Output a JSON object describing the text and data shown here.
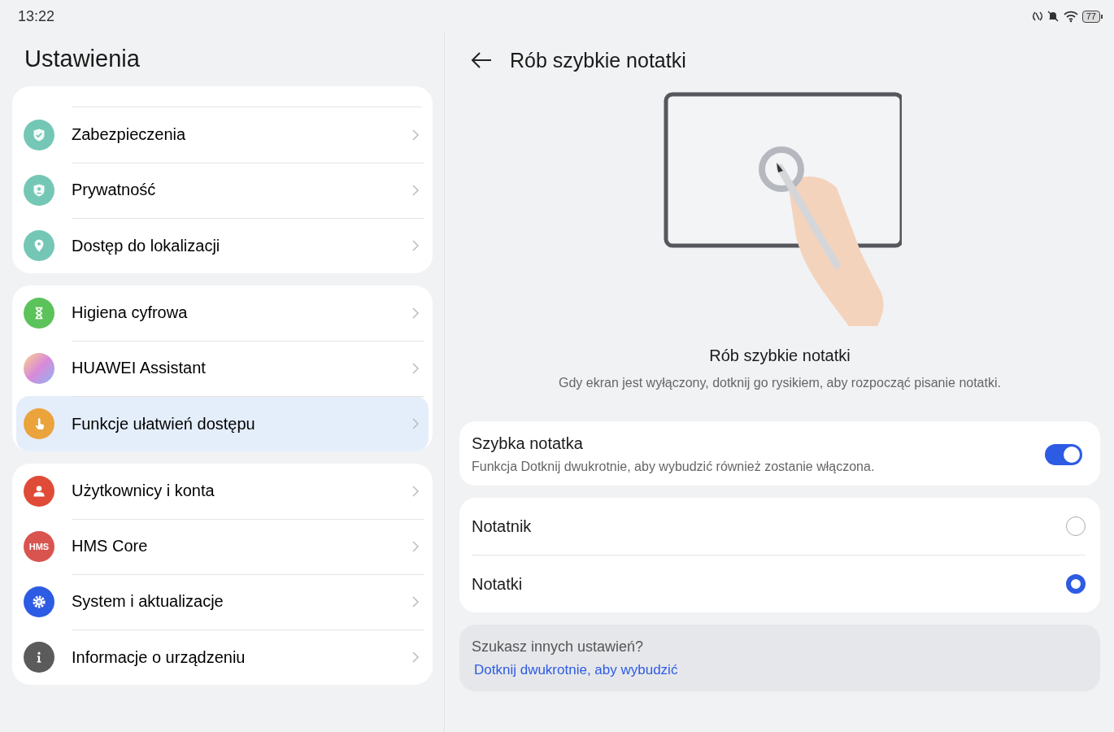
{
  "status_bar": {
    "time": "13:22",
    "battery": "77"
  },
  "sidebar": {
    "title": "Ustawienia",
    "groups": [
      {
        "kind": "scrolled",
        "items": [
          {
            "label": "Zabezpieczenia",
            "kind": "shield",
            "selected": false
          },
          {
            "label": "Prywatność",
            "kind": "privacy",
            "selected": false
          },
          {
            "label": "Dostęp do lokalizacji",
            "kind": "location",
            "selected": false
          }
        ]
      },
      {
        "kind": "full",
        "items": [
          {
            "label": "Higiena cyfrowa",
            "kind": "hourglass",
            "selected": false
          },
          {
            "label": "HUAWEI Assistant",
            "kind": "assistant",
            "selected": false
          },
          {
            "label": "Funkcje ułatwień dostępu",
            "kind": "hand",
            "selected": true
          }
        ]
      },
      {
        "kind": "full",
        "items": [
          {
            "label": "Użytkownicy i konta",
            "kind": "user",
            "selected": false
          },
          {
            "label": "HMS Core",
            "kind": "hms",
            "icon_text": "HMS",
            "selected": false
          },
          {
            "label": "System i aktualizacje",
            "kind": "gear",
            "selected": false
          },
          {
            "label": "Informacje o urządzeniu",
            "kind": "info",
            "selected": false
          }
        ]
      }
    ]
  },
  "detail": {
    "title": "Rób szybkie notatki",
    "heading": "Rób szybkie notatki",
    "description": "Gdy ekran jest wyłączony, dotknij go rysikiem, aby rozpocząć pisanie notatki.",
    "toggle": {
      "label": "Szybka notatka",
      "sublabel": "Funkcja Dotknij dwukrotnie, aby wybudzić również zostanie włączona.",
      "on": true
    },
    "options": [
      {
        "label": "Notatnik",
        "selected": false
      },
      {
        "label": "Notatki",
        "selected": true
      }
    ],
    "more": {
      "title": "Szukasz innych ustawień?",
      "link": "Dotknij dwukrotnie, aby wybudzić"
    }
  }
}
